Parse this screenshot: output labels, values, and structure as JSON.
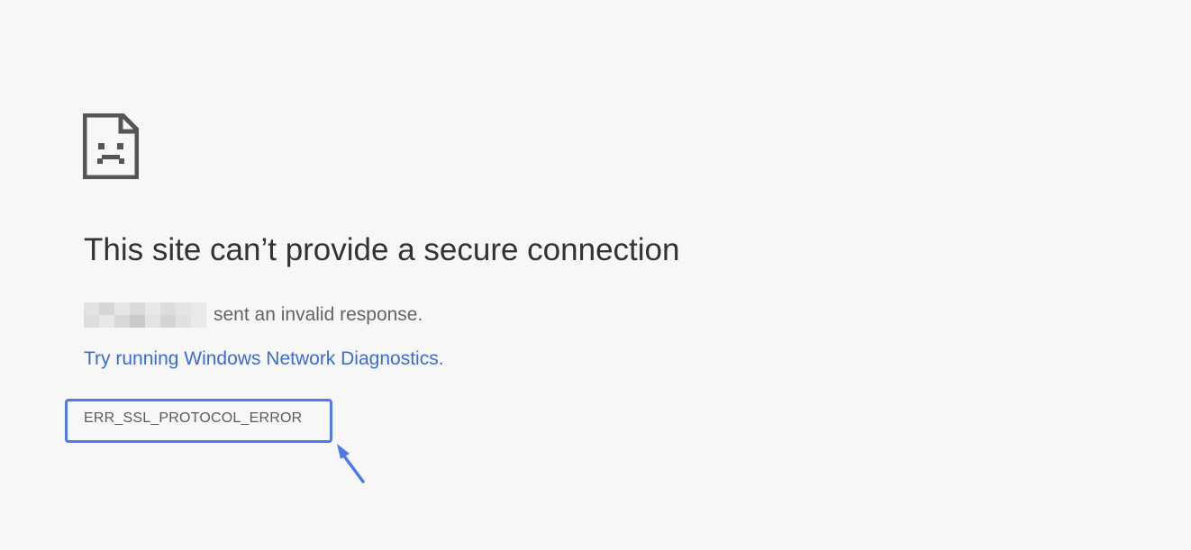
{
  "page": {
    "title": "This site can’t provide a secure connection",
    "message_suffix": "sent an invalid response.",
    "diagnostics_link": "Try running Windows Network Diagnostics.",
    "error_code": "ERR_SSL_PROTOCOL_ERROR"
  },
  "icons": {
    "error_page": "sad-document-icon",
    "annotation": "arrow-pointer-icon"
  },
  "colors": {
    "background": "#f7f7f7",
    "title": "#333333",
    "body_text": "#646464",
    "link": "#3b6bd6",
    "highlight_box": "#4e7be6",
    "error_code": "#5a5a5a",
    "icon": "#555555"
  }
}
